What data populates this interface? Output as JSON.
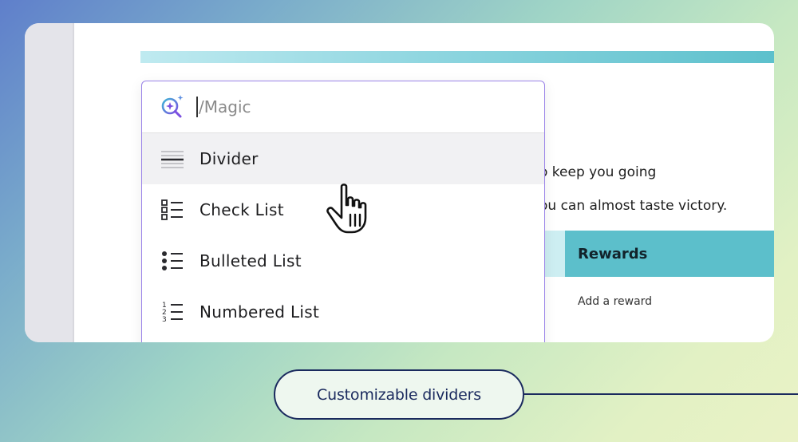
{
  "search": {
    "value": "/Magic"
  },
  "menu": {
    "items": [
      {
        "label": "Divider",
        "icon": "divider-icon",
        "hovered": true
      },
      {
        "label": "Check List",
        "icon": "checklist-icon"
      },
      {
        "label": "Bulleted List",
        "icon": "bulleted-list-icon"
      },
      {
        "label": "Numbered List",
        "icon": "numbered-list-icon"
      }
    ]
  },
  "document": {
    "line1": "o keep you going",
    "line2": "ou can almost taste victory.",
    "rewards_header": "Rewards",
    "add_reward": "Add a reward"
  },
  "caption": {
    "label": "Customizable dividers"
  },
  "colors": {
    "accent": "#9a83e8",
    "teal": "#5cbfcb",
    "navy": "#1a2a5e"
  }
}
